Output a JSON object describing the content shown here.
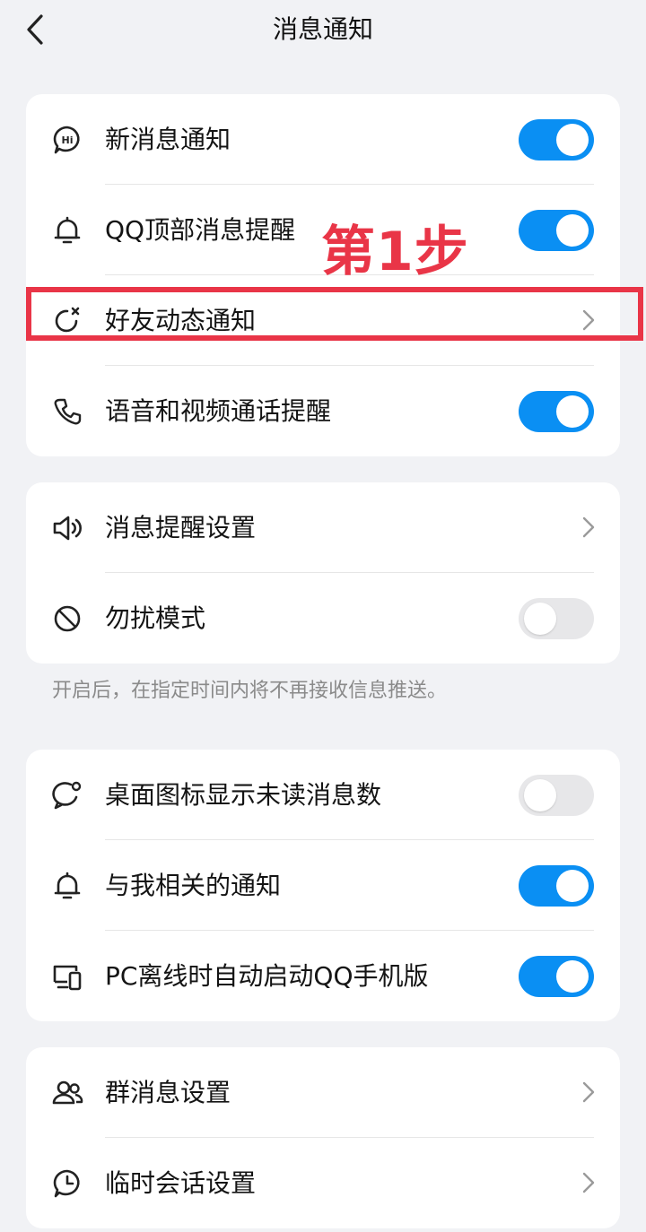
{
  "header": {
    "title": "消息通知",
    "back_icon": "chevron-left-icon"
  },
  "annotation": {
    "step_label": "第1步",
    "color": "#e93547"
  },
  "accent_color": "#0a8ff3",
  "group1": [
    {
      "label": "新消息通知",
      "icon": "hi-chat-icon",
      "toggle": true
    },
    {
      "label": "QQ顶部消息提醒",
      "icon": "bell-icon",
      "toggle": true
    },
    {
      "label": "好友动态通知",
      "icon": "refresh-icon",
      "chevron": true
    },
    {
      "label": "语音和视频通话提醒",
      "icon": "phone-icon",
      "toggle": true
    }
  ],
  "group2": [
    {
      "label": "消息提醒设置",
      "icon": "speaker-icon",
      "chevron": true
    },
    {
      "label": "勿扰模式",
      "icon": "block-icon",
      "toggle": false
    }
  ],
  "group2_hint": "开启后，在指定时间内将不再接收信息推送。",
  "group3": [
    {
      "label": "桌面图标显示未读消息数",
      "icon": "chat-badge-icon",
      "toggle": false
    },
    {
      "label": "与我相关的通知",
      "icon": "bell-icon",
      "toggle": true
    },
    {
      "label": "PC离线时自动启动QQ手机版",
      "icon": "devices-icon",
      "toggle": true
    }
  ],
  "group4": [
    {
      "label": "群消息设置",
      "icon": "group-icon",
      "chevron": true
    },
    {
      "label": "临时会话设置",
      "icon": "clock-chat-icon",
      "chevron": true
    }
  ]
}
